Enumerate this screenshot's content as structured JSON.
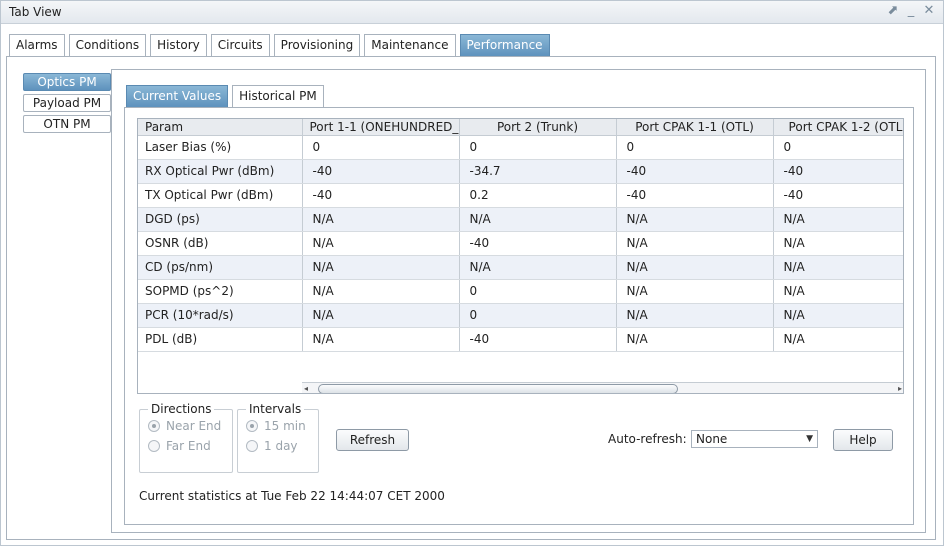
{
  "window": {
    "title": "Tab View",
    "controls": [
      "⬈",
      "_",
      "✕"
    ]
  },
  "top_tabs": [
    {
      "label": "Alarms",
      "active": false
    },
    {
      "label": "Conditions",
      "active": false
    },
    {
      "label": "History",
      "active": false
    },
    {
      "label": "Circuits",
      "active": false
    },
    {
      "label": "Provisioning",
      "active": false
    },
    {
      "label": "Maintenance",
      "active": false
    },
    {
      "label": "Performance",
      "active": true
    }
  ],
  "side_tabs": [
    {
      "label": "Optics PM",
      "active": true
    },
    {
      "label": "Payload PM",
      "active": false
    },
    {
      "label": "OTN PM",
      "active": false
    }
  ],
  "inner_tabs": [
    {
      "label": "Current Values",
      "active": true
    },
    {
      "label": "Historical PM",
      "active": false
    }
  ],
  "table": {
    "headers": [
      "Param",
      "Port 1-1 (ONEHUNDRED_...",
      "Port 2 (Trunk)",
      "Port CPAK 1-1 (OTL)",
      "Port CPAK 1-2 (OTL"
    ],
    "rows": [
      [
        "Laser Bias (%)",
        "0",
        "0",
        "0",
        "0"
      ],
      [
        "RX Optical Pwr (dBm)",
        "-40",
        "-34.7",
        "-40",
        "-40"
      ],
      [
        "TX Optical Pwr (dBm)",
        "-40",
        "0.2",
        "-40",
        "-40"
      ],
      [
        "DGD (ps)",
        "N/A",
        "N/A",
        "N/A",
        "N/A"
      ],
      [
        "OSNR (dB)",
        "N/A",
        "-40",
        "N/A",
        "N/A"
      ],
      [
        "CD (ps/nm)",
        "N/A",
        "N/A",
        "N/A",
        "N/A"
      ],
      [
        "SOPMD (ps^2)",
        "N/A",
        "0",
        "N/A",
        "N/A"
      ],
      [
        "PCR (10*rad/s)",
        "N/A",
        "0",
        "N/A",
        "N/A"
      ],
      [
        "PDL (dB)",
        "N/A",
        "-40",
        "N/A",
        "N/A"
      ]
    ]
  },
  "directions": {
    "legend": "Directions",
    "options": [
      {
        "label": "Near End",
        "selected": true
      },
      {
        "label": "Far End",
        "selected": false
      }
    ]
  },
  "intervals": {
    "legend": "Intervals",
    "options": [
      {
        "label": "15 min",
        "selected": true
      },
      {
        "label": "1 day",
        "selected": false
      }
    ]
  },
  "buttons": {
    "refresh": "Refresh",
    "help": "Help"
  },
  "auto_refresh": {
    "label": "Auto-refresh:",
    "value": "None"
  },
  "status": "Current statistics at Tue Feb 22 14:44:07 CET 2000",
  "icons": {
    "scroll_left": "◂",
    "scroll_right": "▸",
    "dropdown": "▼"
  }
}
